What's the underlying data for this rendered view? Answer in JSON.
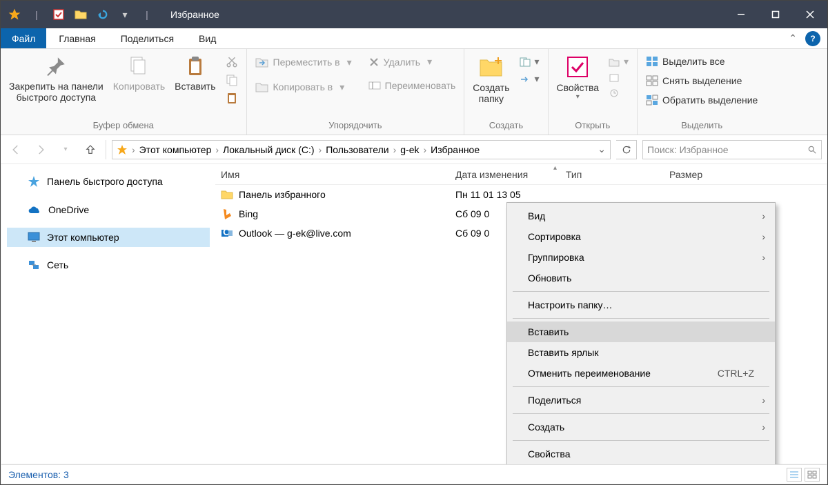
{
  "window": {
    "title": "Избранное"
  },
  "tabs": {
    "file": "Файл",
    "home": "Главная",
    "share": "Поделиться",
    "view": "Вид"
  },
  "ribbon": {
    "clipboard": {
      "pin": "Закрепить на панели\nбыстрого доступа",
      "copy": "Копировать",
      "paste": "Вставить",
      "label": "Буфер обмена"
    },
    "organize": {
      "moveto": "Переместить в",
      "copyto": "Копировать в",
      "delete": "Удалить",
      "rename": "Переименовать",
      "label": "Упорядочить"
    },
    "new_": {
      "folder": "Создать\nпапку",
      "label": "Создать"
    },
    "open": {
      "props": "Свойства",
      "label": "Открыть"
    },
    "select": {
      "all": "Выделить все",
      "none": "Снять выделение",
      "inv": "Обратить выделение",
      "label": "Выделить"
    }
  },
  "breadcrumb": {
    "root": "Этот компьютер",
    "drive": "Локальный диск (C:)",
    "users": "Пользователи",
    "user": "g-ek",
    "fav": "Избранное"
  },
  "search": {
    "placeholder": "Поиск: Избранное"
  },
  "nav": {
    "quick": "Панель быстрого доступа",
    "onedrive": "OneDrive",
    "thispc": "Этот компьютер",
    "network": "Сеть"
  },
  "columns": {
    "name": "Имя",
    "date": "Дата изменения",
    "type": "Тип",
    "size": "Размер"
  },
  "rows": [
    {
      "name": "Панель избранного",
      "date": "Пн 11 01 13 05"
    },
    {
      "name": "Bing",
      "date": "Сб 09 0"
    },
    {
      "name": "Outlook — g-ek@live.com",
      "date": "Сб 09 0"
    }
  ],
  "context": {
    "view": "Вид",
    "sort": "Сортировка",
    "group": "Группировка",
    "refresh": "Обновить",
    "customize": "Настроить папку…",
    "paste": "Вставить",
    "paste_shortcut": "Вставить ярлык",
    "undo_rename": "Отменить переименование",
    "undo_accel": "CTRL+Z",
    "share": "Поделиться",
    "new_": "Создать",
    "props": "Свойства"
  },
  "status": {
    "items": "Элементов: 3"
  }
}
